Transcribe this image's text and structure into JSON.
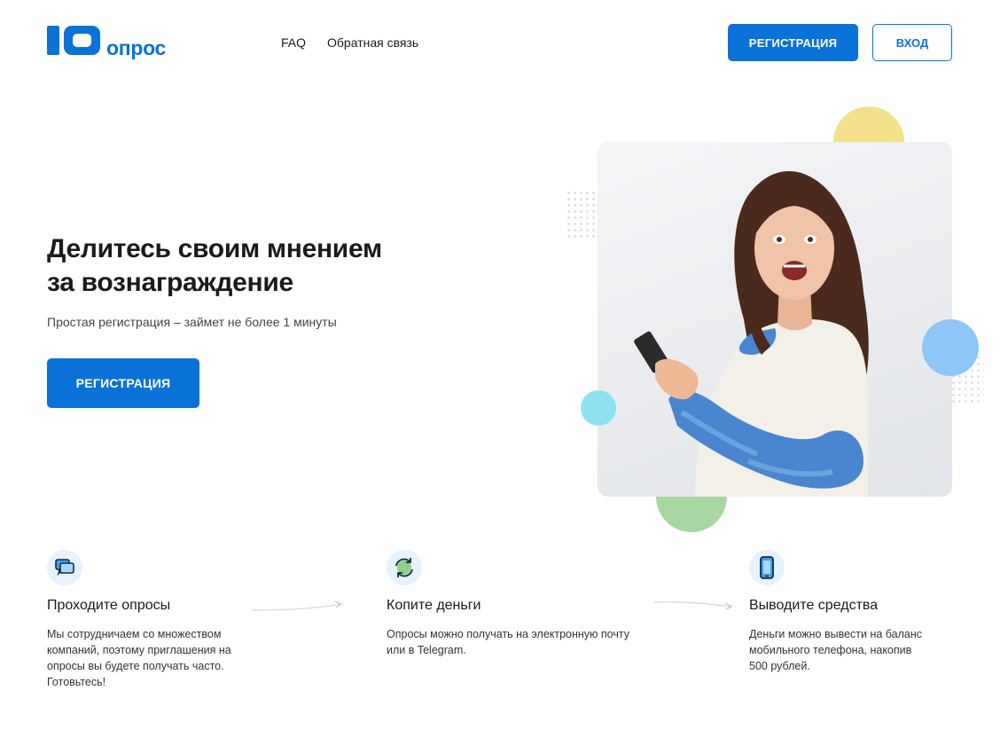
{
  "header": {
    "logo_text": "опрос",
    "logo_mark_text": "10",
    "nav": [
      {
        "label": "FAQ"
      },
      {
        "label": "Обратная связь"
      }
    ],
    "register_label": "РЕГИСТРАЦИЯ",
    "login_label": "ВХОД"
  },
  "hero": {
    "title_line1": "Делитесь своим мнением",
    "title_line2_prefix": "за ",
    "title_line2_highlight": "вознаграждение",
    "subtitle": "Простая регистрация – займет не более 1 минуты",
    "cta_label": "РЕГИСТРАЦИЯ"
  },
  "features": [
    {
      "icon": "chat-bubbles-icon",
      "title": "Проходите опросы",
      "text": "Мы сотрудничаем со множеством компаний, поэтому приглашения на опросы вы будете получать часто. Готовьтесь!"
    },
    {
      "icon": "refresh-coins-icon",
      "title": "Копите деньги",
      "text": "Опросы можно получать на электронную почту или в Telegram."
    },
    {
      "icon": "smartphone-icon",
      "title": "Выводите средства",
      "text": "Деньги можно вывести на баланс мобильного телефона, накопив 500 рублей."
    }
  ],
  "colors": {
    "brand": "#0b72d8",
    "highlight": "#7ec0f5",
    "circle_yellow": "#f3e08a",
    "circle_blue": "#8ec6f7",
    "circle_cyan": "#8fe3f0",
    "circle_green": "#a8d8a2"
  }
}
